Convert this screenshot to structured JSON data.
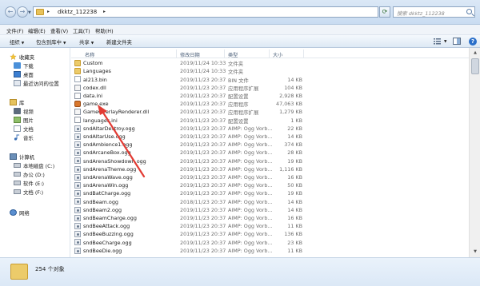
{
  "address": {
    "path": "dkktz_112238",
    "search_placeholder": "搜索 dkktz_112238"
  },
  "menu": [
    "文件(F)",
    "编辑(E)",
    "查看(V)",
    "工具(T)",
    "帮助(H)"
  ],
  "toolbar": {
    "organize": "组织",
    "include_library": "包含到库中",
    "share": "共享",
    "new_folder": "新建文件夹"
  },
  "nav": {
    "favorites": "收藏夹",
    "downloads": "下载",
    "desktop": "桌面",
    "recent": "最近访问的位置",
    "libraries": "库",
    "videos": "视频",
    "pictures": "图片",
    "documents": "文档",
    "music": "音乐",
    "computer": "计算机",
    "drive_c": "本地磁盘 (C:)",
    "drive_d": "办公 (D:)",
    "drive_e": "软件 (E:)",
    "drive_f": "文档 (F:)",
    "network": "网络"
  },
  "columns": {
    "name": "名称",
    "date": "修改日期",
    "type": "类型",
    "size": "大小"
  },
  "files": [
    {
      "name": "Custom",
      "date": "2019/11/24 10:33",
      "type": "文件夹",
      "size": "",
      "icon": "folder"
    },
    {
      "name": "Languages",
      "date": "2019/11/24 10:33",
      "type": "文件夹",
      "size": "",
      "icon": "folder"
    },
    {
      "name": "al213.bin",
      "date": "2019/11/23 20:37",
      "type": "BIN 文件",
      "size": "14 KB",
      "icon": "doc"
    },
    {
      "name": "codex.dll",
      "date": "2019/11/23 20:37",
      "type": "应用程序扩展",
      "size": "104 KB",
      "icon": "dll"
    },
    {
      "name": "data.ini",
      "date": "2019/11/23 20:37",
      "type": "配置设置",
      "size": "2,928 KB",
      "icon": "ini"
    },
    {
      "name": "game.exe",
      "date": "2019/11/23 20:37",
      "type": "应用程序",
      "size": "47,063 KB",
      "icon": "exe"
    },
    {
      "name": "GameOverlayRenderer.dll",
      "date": "2019/11/23 20:37",
      "type": "应用程序扩展",
      "size": "1,279 KB",
      "icon": "dll"
    },
    {
      "name": "languages.ini",
      "date": "2019/11/23 20:37",
      "type": "配置设置",
      "size": "1 KB",
      "icon": "ini"
    },
    {
      "name": "sndAltarDestroy.ogg",
      "date": "2019/11/23 20:37",
      "type": "AIMP: Ogg Vorb...",
      "size": "22 KB",
      "icon": "ogg"
    },
    {
      "name": "sndAltarUse.ogg",
      "date": "2019/11/23 20:37",
      "type": "AIMP: Ogg Vorb...",
      "size": "14 KB",
      "icon": "ogg"
    },
    {
      "name": "sndAmbience1.ogg",
      "date": "2019/11/23 20:37",
      "type": "AIMP: Ogg Vorb...",
      "size": "374 KB",
      "icon": "ogg"
    },
    {
      "name": "sndArcaneBox.ogg",
      "date": "2019/11/23 20:37",
      "type": "AIMP: Ogg Vorb...",
      "size": "28 KB",
      "icon": "ogg"
    },
    {
      "name": "sndArenaShowdown.ogg",
      "date": "2019/11/23 20:37",
      "type": "AIMP: Ogg Vorb...",
      "size": "19 KB",
      "icon": "ogg"
    },
    {
      "name": "sndArenaTheme.ogg",
      "date": "2019/11/23 20:37",
      "type": "AIMP: Ogg Vorb...",
      "size": "1,116 KB",
      "icon": "ogg"
    },
    {
      "name": "sndArenaWave.ogg",
      "date": "2019/11/23 20:37",
      "type": "AIMP: Ogg Vorb...",
      "size": "16 KB",
      "icon": "ogg"
    },
    {
      "name": "sndArenaWin.ogg",
      "date": "2019/11/23 20:37",
      "type": "AIMP: Ogg Vorb...",
      "size": "50 KB",
      "icon": "ogg"
    },
    {
      "name": "sndBatCharge.ogg",
      "date": "2019/11/23 20:37",
      "type": "AIMP: Ogg Vorb...",
      "size": "19 KB",
      "icon": "ogg"
    },
    {
      "name": "sndBeam.ogg",
      "date": "2018/11/23 20:37",
      "type": "AIMP: Ogg Vorb...",
      "size": "14 KB",
      "icon": "ogg"
    },
    {
      "name": "sndBeam2.ogg",
      "date": "2019/11/23 20:37",
      "type": "AIMP: Ogg Vorb...",
      "size": "14 KB",
      "icon": "ogg"
    },
    {
      "name": "sndBeamCharge.ogg",
      "date": "2019/11/23 20:37",
      "type": "AIMP: Ogg Vorb...",
      "size": "16 KB",
      "icon": "ogg"
    },
    {
      "name": "sndBeeAttack.ogg",
      "date": "2019/11/23 20:37",
      "type": "AIMP: Ogg Vorb...",
      "size": "11 KB",
      "icon": "ogg"
    },
    {
      "name": "sndBeeBuzzing.ogg",
      "date": "2019/11/23 20:37",
      "type": "AIMP: Ogg Vorb...",
      "size": "136 KB",
      "icon": "ogg"
    },
    {
      "name": "sndBeeCharge.ogg",
      "date": "2019/11/23 20:37",
      "type": "AIMP: Ogg Vorb...",
      "size": "23 KB",
      "icon": "ogg"
    },
    {
      "name": "sndBeeDie.ogg",
      "date": "2019/11/23 20:37",
      "type": "AIMP: Ogg Vorb...",
      "size": "11 KB",
      "icon": "ogg"
    }
  ],
  "status": {
    "count": "254 个对象"
  },
  "colors": {
    "arrow": "#e23b33",
    "accent": "#2a6fc9"
  }
}
